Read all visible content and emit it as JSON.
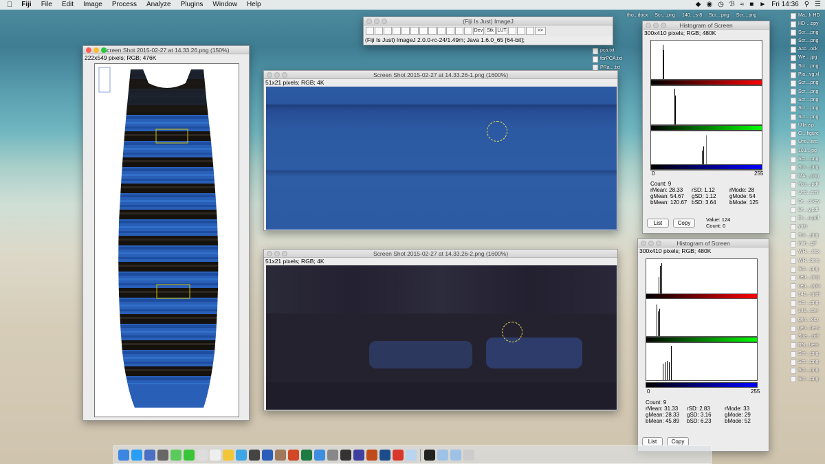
{
  "menubar": {
    "app": "Fiji",
    "items": [
      "File",
      "Edit",
      "Image",
      "Process",
      "Analyze",
      "Plugins",
      "Window",
      "Help"
    ],
    "clock": "Fri 14:36"
  },
  "toolbar_win": {
    "title": "(Fiji Is Just) ImageJ",
    "status": "(Fiji Is Just) ImageJ 2.0.0-rc-24/1.49m; Java 1.6.0_65 [64-bit];",
    "tools": [
      "rect-tool",
      "oval-tool",
      "polygon-tool",
      "freehand-tool",
      "line-tool",
      "angle-tool",
      "point-tool",
      "wand-tool",
      "text-tool",
      "magnifier-tool",
      "hand-tool",
      "color-picker",
      "Dev",
      "Stk",
      "LUT",
      "pen-tool",
      "pipette-tool",
      "brush-tool",
      ">>"
    ]
  },
  "dress_win": {
    "title": "Screen Shot 2015-02-27 at 14.33.26.png (150%)",
    "info": "222x549 pixels; RGB; 476K"
  },
  "crop1": {
    "title": "Screen Shot 2015-02-27 at 14.33.26-1.png (1600%)",
    "info": "51x21 pixels; RGB; 4K"
  },
  "crop2": {
    "title": "Screen Shot 2015-02-27 at 14.33.26-2.png (1600%)",
    "info": "51x21 pixels; RGB; 4K"
  },
  "hist1": {
    "title": "Histogram of Screen",
    "info": "300x410 pixels; RGB; 480K",
    "axis_min": "0",
    "axis_max": "255",
    "count": "Count: 9",
    "rMean": "rMean: 28.33",
    "rSD": "rSD: 1.12",
    "rMode": "rMode: 28",
    "gMean": "gMean: 54.67",
    "gSD": "gSD: 1.12",
    "gMode": "gMode: 54",
    "bMean": "bMean: 120.67",
    "bSD": "bSD: 3.64",
    "bMode": "bMode: 125",
    "list": "List",
    "copy": "Copy",
    "value": "Value: 124",
    "count2": "Count: 0"
  },
  "hist2": {
    "title": "Histogram of Screen",
    "info": "300x410 pixels; RGB; 480K",
    "axis_min": "0",
    "axis_max": "255",
    "count": "Count: 9",
    "rMean": "rMean: 31.33",
    "rSD": "rSD: 2.83",
    "rMode": "rMode: 33",
    "gMean": "gMean: 28.33",
    "gSD": "gSD: 3.16",
    "gMode": "gMode: 29",
    "bMean": "bMean: 45.89",
    "bSD": "bSD: 6.23",
    "bMode": "bMode: 52",
    "list": "List",
    "copy": "Copy"
  },
  "desktop_files_a": [
    "pca.txt",
    "forPCA.txt",
    "PRa....txt"
  ],
  "desktop_files_b": [
    "tho...docx",
    "Scr....png",
    "140....s-8",
    "Scr....png",
    "Scr....png"
  ],
  "desktop_files_c": [
    "Ma...h HD",
    "HD-...opy",
    "Scr....png",
    "Scr....png",
    "Acc...ock",
    "We....jpg",
    "Scr....png",
    "Pla...vg.xl",
    "Scr....png",
    "Scr....png",
    "Scr....png",
    "Scr....png",
    "Scr....png",
    "Ulla.zip",
    "Cl...figure",
    "Unti...ers",
    "103...jpg",
    "Scr....png",
    "Scr....png",
    "MA....png",
    "You....pdf",
    "Unti...eml",
    "Dr....o.key",
    "Dr....y.pdf",
    "Dr....o.pdf",
    "yuju",
    "Scr....png",
    "inlin...gif",
    "WR....xlsx",
    "WR...bers",
    "Scr....png",
    "cep....png",
    "cep....pptx",
    "141...r.pdf",
    "Scr....png",
    "141...ster",
    "gen...xlsx",
    "gen...bers",
    "Spa....pdf",
    "RN...bers",
    "Scr....png",
    "Scr....png",
    "Scr....png",
    "Scr....png"
  ]
}
